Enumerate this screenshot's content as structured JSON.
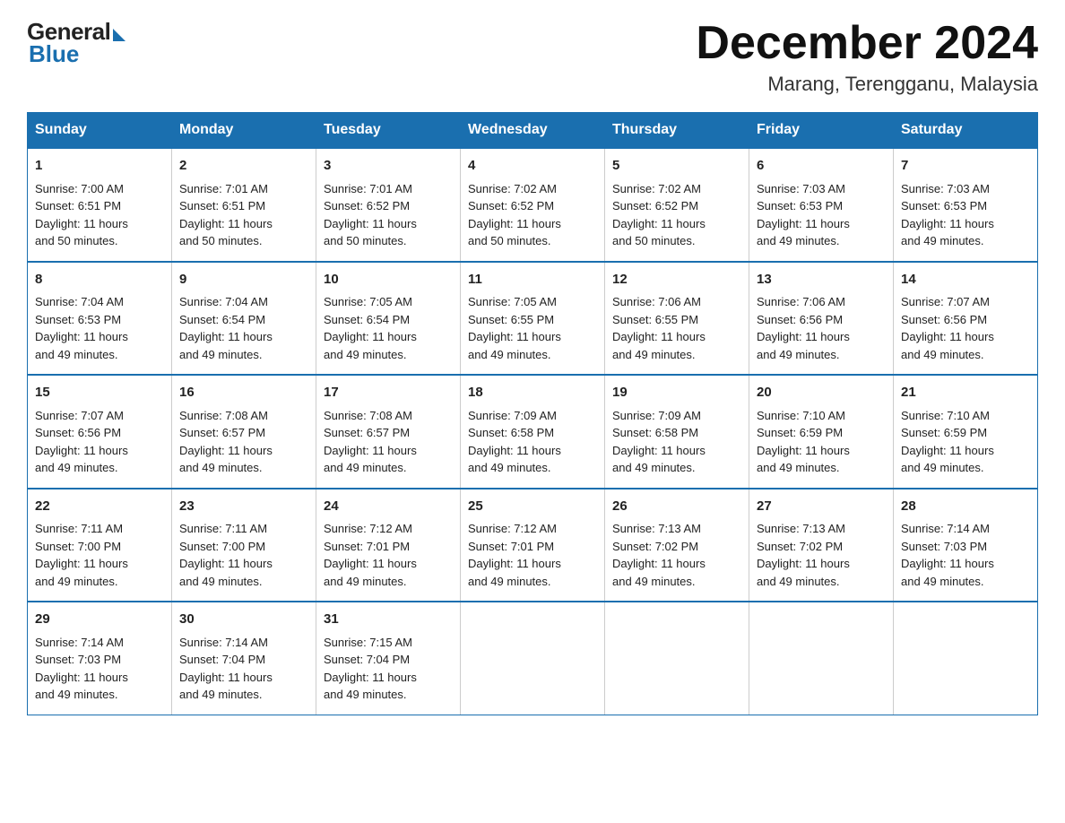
{
  "header": {
    "logo": {
      "general": "General",
      "blue": "Blue"
    },
    "title": "December 2024",
    "location": "Marang, Terengganu, Malaysia"
  },
  "days_of_week": [
    "Sunday",
    "Monday",
    "Tuesday",
    "Wednesday",
    "Thursday",
    "Friday",
    "Saturday"
  ],
  "weeks": [
    [
      {
        "day": "1",
        "info": "Sunrise: 7:00 AM\nSunset: 6:51 PM\nDaylight: 11 hours\nand 50 minutes."
      },
      {
        "day": "2",
        "info": "Sunrise: 7:01 AM\nSunset: 6:51 PM\nDaylight: 11 hours\nand 50 minutes."
      },
      {
        "day": "3",
        "info": "Sunrise: 7:01 AM\nSunset: 6:52 PM\nDaylight: 11 hours\nand 50 minutes."
      },
      {
        "day": "4",
        "info": "Sunrise: 7:02 AM\nSunset: 6:52 PM\nDaylight: 11 hours\nand 50 minutes."
      },
      {
        "day": "5",
        "info": "Sunrise: 7:02 AM\nSunset: 6:52 PM\nDaylight: 11 hours\nand 50 minutes."
      },
      {
        "day": "6",
        "info": "Sunrise: 7:03 AM\nSunset: 6:53 PM\nDaylight: 11 hours\nand 49 minutes."
      },
      {
        "day": "7",
        "info": "Sunrise: 7:03 AM\nSunset: 6:53 PM\nDaylight: 11 hours\nand 49 minutes."
      }
    ],
    [
      {
        "day": "8",
        "info": "Sunrise: 7:04 AM\nSunset: 6:53 PM\nDaylight: 11 hours\nand 49 minutes."
      },
      {
        "day": "9",
        "info": "Sunrise: 7:04 AM\nSunset: 6:54 PM\nDaylight: 11 hours\nand 49 minutes."
      },
      {
        "day": "10",
        "info": "Sunrise: 7:05 AM\nSunset: 6:54 PM\nDaylight: 11 hours\nand 49 minutes."
      },
      {
        "day": "11",
        "info": "Sunrise: 7:05 AM\nSunset: 6:55 PM\nDaylight: 11 hours\nand 49 minutes."
      },
      {
        "day": "12",
        "info": "Sunrise: 7:06 AM\nSunset: 6:55 PM\nDaylight: 11 hours\nand 49 minutes."
      },
      {
        "day": "13",
        "info": "Sunrise: 7:06 AM\nSunset: 6:56 PM\nDaylight: 11 hours\nand 49 minutes."
      },
      {
        "day": "14",
        "info": "Sunrise: 7:07 AM\nSunset: 6:56 PM\nDaylight: 11 hours\nand 49 minutes."
      }
    ],
    [
      {
        "day": "15",
        "info": "Sunrise: 7:07 AM\nSunset: 6:56 PM\nDaylight: 11 hours\nand 49 minutes."
      },
      {
        "day": "16",
        "info": "Sunrise: 7:08 AM\nSunset: 6:57 PM\nDaylight: 11 hours\nand 49 minutes."
      },
      {
        "day": "17",
        "info": "Sunrise: 7:08 AM\nSunset: 6:57 PM\nDaylight: 11 hours\nand 49 minutes."
      },
      {
        "day": "18",
        "info": "Sunrise: 7:09 AM\nSunset: 6:58 PM\nDaylight: 11 hours\nand 49 minutes."
      },
      {
        "day": "19",
        "info": "Sunrise: 7:09 AM\nSunset: 6:58 PM\nDaylight: 11 hours\nand 49 minutes."
      },
      {
        "day": "20",
        "info": "Sunrise: 7:10 AM\nSunset: 6:59 PM\nDaylight: 11 hours\nand 49 minutes."
      },
      {
        "day": "21",
        "info": "Sunrise: 7:10 AM\nSunset: 6:59 PM\nDaylight: 11 hours\nand 49 minutes."
      }
    ],
    [
      {
        "day": "22",
        "info": "Sunrise: 7:11 AM\nSunset: 7:00 PM\nDaylight: 11 hours\nand 49 minutes."
      },
      {
        "day": "23",
        "info": "Sunrise: 7:11 AM\nSunset: 7:00 PM\nDaylight: 11 hours\nand 49 minutes."
      },
      {
        "day": "24",
        "info": "Sunrise: 7:12 AM\nSunset: 7:01 PM\nDaylight: 11 hours\nand 49 minutes."
      },
      {
        "day": "25",
        "info": "Sunrise: 7:12 AM\nSunset: 7:01 PM\nDaylight: 11 hours\nand 49 minutes."
      },
      {
        "day": "26",
        "info": "Sunrise: 7:13 AM\nSunset: 7:02 PM\nDaylight: 11 hours\nand 49 minutes."
      },
      {
        "day": "27",
        "info": "Sunrise: 7:13 AM\nSunset: 7:02 PM\nDaylight: 11 hours\nand 49 minutes."
      },
      {
        "day": "28",
        "info": "Sunrise: 7:14 AM\nSunset: 7:03 PM\nDaylight: 11 hours\nand 49 minutes."
      }
    ],
    [
      {
        "day": "29",
        "info": "Sunrise: 7:14 AM\nSunset: 7:03 PM\nDaylight: 11 hours\nand 49 minutes."
      },
      {
        "day": "30",
        "info": "Sunrise: 7:14 AM\nSunset: 7:04 PM\nDaylight: 11 hours\nand 49 minutes."
      },
      {
        "day": "31",
        "info": "Sunrise: 7:15 AM\nSunset: 7:04 PM\nDaylight: 11 hours\nand 49 minutes."
      },
      {
        "day": "",
        "info": ""
      },
      {
        "day": "",
        "info": ""
      },
      {
        "day": "",
        "info": ""
      },
      {
        "day": "",
        "info": ""
      }
    ]
  ]
}
